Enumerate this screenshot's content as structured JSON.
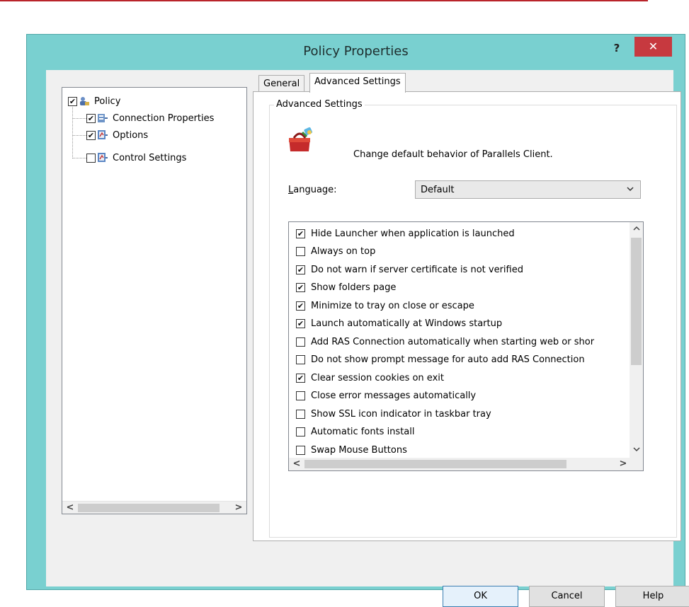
{
  "window": {
    "title": "Policy Properties",
    "help_label": "?",
    "close_label": "✕"
  },
  "tree": {
    "items": [
      {
        "label": "Policy",
        "checked": true,
        "icon": "policy-icon"
      },
      {
        "label": "Connection Properties",
        "checked": true,
        "icon": "connection-properties-icon"
      },
      {
        "label": "Options",
        "checked": true,
        "icon": "options-icon"
      },
      {
        "label": "Control Settings",
        "checked": false,
        "icon": "control-settings-icon"
      }
    ],
    "scroll_left": "<",
    "scroll_right": ">"
  },
  "tabs": [
    {
      "label": "General",
      "active": false
    },
    {
      "label": "Advanced Settings",
      "active": true
    }
  ],
  "panel": {
    "group_title": "Advanced Settings",
    "description": "Change default behavior of Parallels Client.",
    "language_label_prefix": "",
    "language_label_access": "L",
    "language_label_rest": "anguage:",
    "language_value": "Default",
    "select_arrow": "⌄"
  },
  "options": [
    {
      "label": "Hide Launcher when application is launched",
      "checked": true
    },
    {
      "label": "Always on top",
      "checked": false
    },
    {
      "label": "Do not warn if server certificate is not verified",
      "checked": true
    },
    {
      "label": "Show folders page",
      "checked": true
    },
    {
      "label": "Minimize to tray on close or escape",
      "checked": true
    },
    {
      "label": "Launch automatically at Windows startup",
      "checked": true
    },
    {
      "label": "Add RAS Connection automatically when starting web or shor",
      "checked": false
    },
    {
      "label": "Do not show prompt message for auto add RAS Connection",
      "checked": false
    },
    {
      "label": "Clear session cookies on exit",
      "checked": true
    },
    {
      "label": "Close error messages automatically",
      "checked": false
    },
    {
      "label": "Show SSL icon indicator in taskbar tray",
      "checked": false
    },
    {
      "label": "Automatic fonts install",
      "checked": false
    },
    {
      "label": "Swap Mouse Buttons",
      "checked": false
    }
  ],
  "list_scroll": {
    "up": "^",
    "down": "v",
    "left": "<",
    "right": ">"
  },
  "buttons": {
    "ok": "OK",
    "cancel": "Cancel",
    "help": "Help"
  },
  "colors": {
    "title_bar": "#79d0d0",
    "close_button": "#c7393f",
    "top_accent": "#b9242a"
  }
}
